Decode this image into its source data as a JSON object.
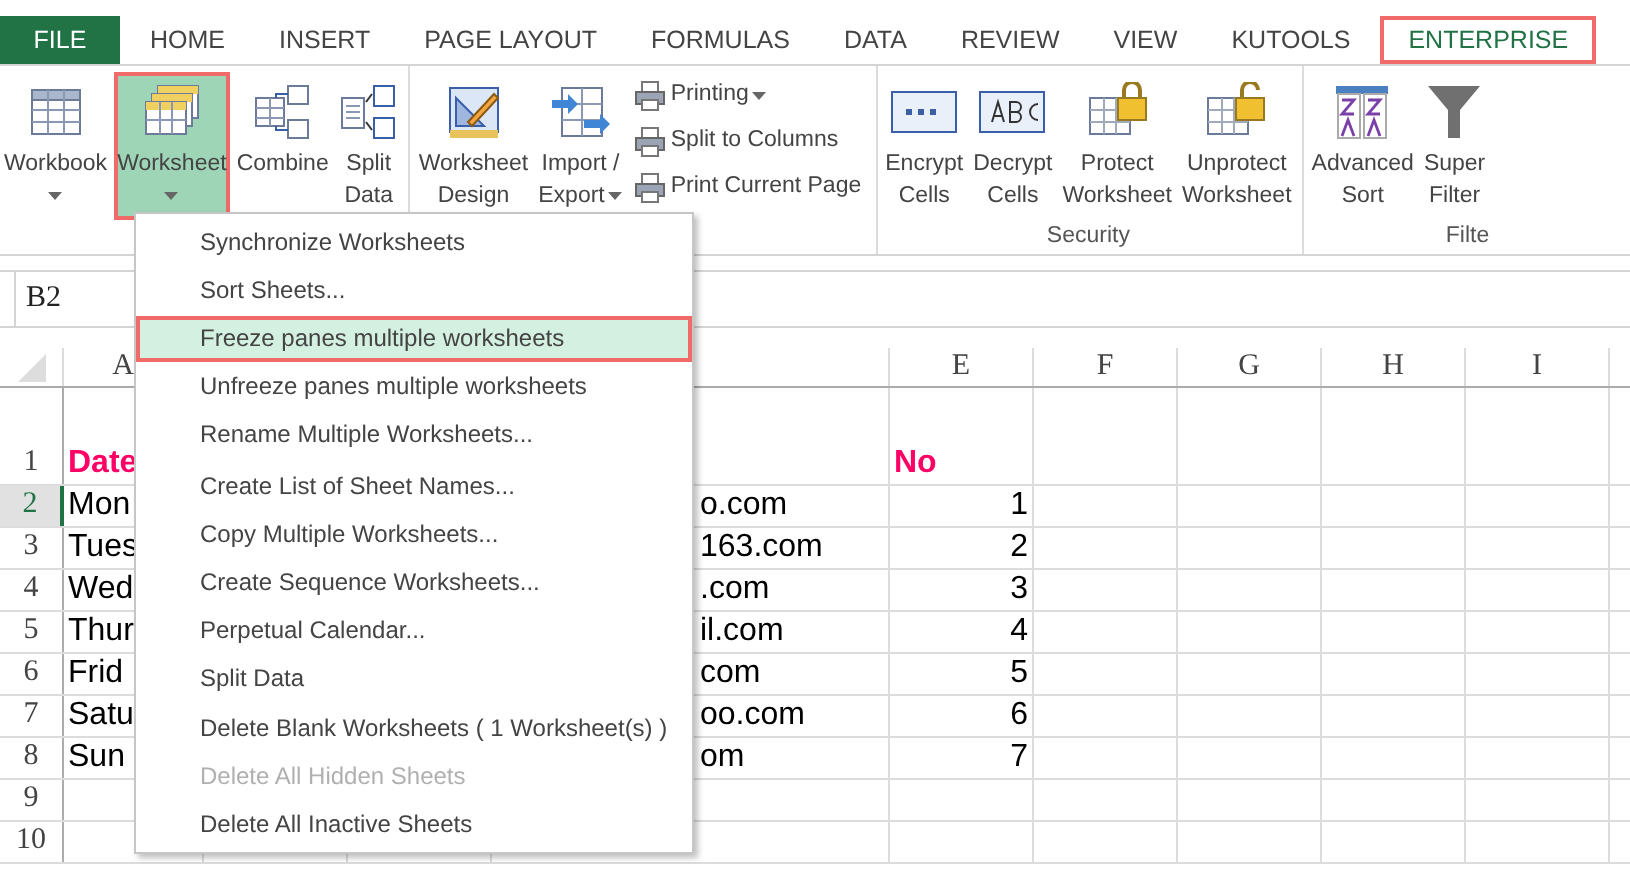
{
  "tabs": [
    {
      "label": "FILE",
      "kind": "file",
      "selected": false,
      "highlighted": false
    },
    {
      "label": "HOME",
      "kind": "tab",
      "selected": false,
      "highlighted": false
    },
    {
      "label": "INSERT",
      "kind": "tab",
      "selected": false,
      "highlighted": false
    },
    {
      "label": "PAGE LAYOUT",
      "kind": "tab",
      "selected": false,
      "highlighted": false
    },
    {
      "label": "FORMULAS",
      "kind": "tab",
      "selected": false,
      "highlighted": false
    },
    {
      "label": "DATA",
      "kind": "tab",
      "selected": false,
      "highlighted": false
    },
    {
      "label": "REVIEW",
      "kind": "tab",
      "selected": false,
      "highlighted": false
    },
    {
      "label": "VIEW",
      "kind": "tab",
      "selected": false,
      "highlighted": false
    },
    {
      "label": "KUTOOLS",
      "kind": "tab",
      "selected": false,
      "highlighted": false
    },
    {
      "label": "ENTERPRISE",
      "kind": "tab",
      "selected": true,
      "highlighted": true
    }
  ],
  "ribbon": {
    "groups": [
      {
        "buttons": [
          {
            "kind": "large",
            "lines": [
              "Workbook"
            ],
            "dropdown": true,
            "selected": false,
            "highlighted": false
          },
          {
            "kind": "large",
            "lines": [
              "Worksheet"
            ],
            "dropdown": true,
            "selected": true,
            "highlighted": true
          },
          {
            "kind": "large",
            "lines": [
              "Combine"
            ],
            "dropdown": false,
            "selected": false,
            "highlighted": false
          },
          {
            "kind": "large",
            "lines": [
              "Split",
              "Data"
            ],
            "dropdown": false,
            "selected": false,
            "highlighted": false
          }
        ]
      },
      {
        "buttons": [
          {
            "kind": "large",
            "lines": [
              "Worksheet",
              "Design"
            ],
            "dropdown": false,
            "selected": false,
            "highlighted": false
          },
          {
            "kind": "large",
            "lines": [
              "Import /",
              "Export"
            ],
            "dropdown": true,
            "selected": false,
            "highlighted": false
          },
          {
            "kind": "small",
            "label": "Printing",
            "dropdown": true
          },
          {
            "kind": "small",
            "label": "Split to Columns",
            "dropdown": false
          },
          {
            "kind": "small",
            "label": "Print Current Page",
            "dropdown": false
          }
        ]
      },
      {
        "label": "Security",
        "buttons": [
          {
            "kind": "large",
            "lines": [
              "Encrypt",
              "Cells"
            ],
            "dropdown": false,
            "selected": false,
            "highlighted": false
          },
          {
            "kind": "large",
            "lines": [
              "Decrypt",
              "Cells"
            ],
            "dropdown": false,
            "selected": false,
            "highlighted": false
          },
          {
            "kind": "large",
            "lines": [
              "Protect",
              "Worksheet"
            ],
            "dropdown": false,
            "selected": false,
            "highlighted": false
          },
          {
            "kind": "large",
            "lines": [
              "Unprotect",
              "Worksheet"
            ],
            "dropdown": false,
            "selected": false,
            "highlighted": false
          }
        ]
      },
      {
        "label": "Filte",
        "buttons": [
          {
            "kind": "large",
            "lines": [
              "Advanced",
              "Sort"
            ],
            "dropdown": false,
            "selected": false,
            "highlighted": false
          },
          {
            "kind": "large",
            "lines": [
              "Super",
              "Filter"
            ],
            "dropdown": false,
            "selected": false,
            "highlighted": false
          }
        ]
      }
    ]
  },
  "name_box": "B2",
  "column_headers": [
    "A",
    "E",
    "F",
    "G",
    "H",
    "I"
  ],
  "rows": [
    {
      "number": "1",
      "selected": false,
      "a": "Date",
      "e": "No",
      "kind": "header"
    },
    {
      "number": "2",
      "selected": true,
      "a": "Mon",
      "d": "o.com",
      "e": "1",
      "kind": "data"
    },
    {
      "number": "3",
      "selected": false,
      "a": "Tues",
      "d": "163.com",
      "e": "2",
      "kind": "data"
    },
    {
      "number": "4",
      "selected": false,
      "a": "Wed",
      "d": ".com",
      "e": "3",
      "kind": "data"
    },
    {
      "number": "5",
      "selected": false,
      "a": "Thur",
      "d": "il.com",
      "e": "4",
      "kind": "data"
    },
    {
      "number": "6",
      "selected": false,
      "a": "Frid",
      "d": "com",
      "e": "5",
      "kind": "data"
    },
    {
      "number": "7",
      "selected": false,
      "a": "Satu",
      "d": "oo.com",
      "e": "6",
      "kind": "data"
    },
    {
      "number": "8",
      "selected": false,
      "a": "Sun",
      "d": "om",
      "e": "7",
      "kind": "data"
    },
    {
      "number": "9",
      "selected": false,
      "kind": "data"
    },
    {
      "number": "10",
      "selected": false,
      "kind": "data"
    }
  ],
  "menu": {
    "items": [
      {
        "label": "Synchronize Worksheets",
        "selected": false,
        "disabled": false,
        "highlighted": false,
        "separator_above": false
      },
      {
        "label": "Sort Sheets...",
        "selected": false,
        "disabled": false,
        "highlighted": false,
        "separator_above": false
      },
      {
        "label": "Freeze panes multiple worksheets",
        "selected": true,
        "disabled": false,
        "highlighted": true,
        "separator_above": false
      },
      {
        "label": "Unfreeze panes multiple worksheets",
        "selected": false,
        "disabled": false,
        "highlighted": false,
        "separator_above": false
      },
      {
        "label": "Rename Multiple Worksheets...",
        "selected": false,
        "disabled": false,
        "highlighted": false,
        "separator_above": false
      },
      {
        "label": "Create List of Sheet Names...",
        "selected": false,
        "disabled": false,
        "highlighted": false,
        "separator_above": true
      },
      {
        "label": "Copy Multiple Worksheets...",
        "selected": false,
        "disabled": false,
        "highlighted": false,
        "separator_above": false
      },
      {
        "label": "Create Sequence Worksheets...",
        "selected": false,
        "disabled": false,
        "highlighted": false,
        "separator_above": false
      },
      {
        "label": "Perpetual Calendar...",
        "selected": false,
        "disabled": false,
        "highlighted": false,
        "separator_above": false
      },
      {
        "label": "Split Data",
        "selected": false,
        "disabled": false,
        "highlighted": false,
        "separator_above": false
      },
      {
        "label": "Delete Blank Worksheets ( 1 Worksheet(s) )",
        "selected": false,
        "disabled": false,
        "highlighted": false,
        "separator_above": true
      },
      {
        "label": "Delete All Hidden Sheets",
        "selected": false,
        "disabled": true,
        "highlighted": false,
        "separator_above": false
      },
      {
        "label": "Delete All Inactive Sheets",
        "selected": false,
        "disabled": false,
        "highlighted": false,
        "separator_above": false
      }
    ]
  }
}
